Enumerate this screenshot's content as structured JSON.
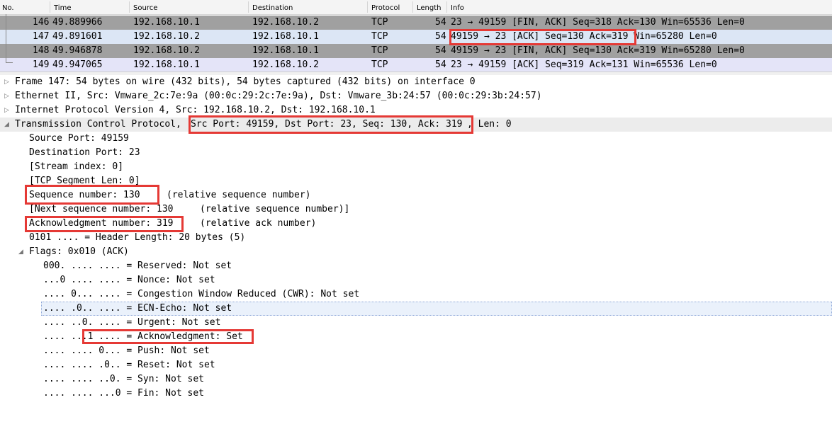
{
  "packet_list": {
    "headers": [
      "No.",
      "Time",
      "Source",
      "Destination",
      "Protocol",
      "Length",
      "Info"
    ],
    "rows": [
      {
        "no": "146",
        "time": "49.889966",
        "source": "192.168.10.1",
        "destination": "192.168.10.2",
        "protocol": "TCP",
        "length": "54",
        "info": "23 → 49159 [FIN, ACK] Seq=318 Ack=130 Win=65536 Len=0"
      },
      {
        "no": "147",
        "time": "49.891601",
        "source": "192.168.10.2",
        "destination": "192.168.10.1",
        "protocol": "TCP",
        "length": "54",
        "info": "49159 → 23 [ACK] Seq=130 Ack=319 Win=65280 Len=0"
      },
      {
        "no": "148",
        "time": "49.946878",
        "source": "192.168.10.2",
        "destination": "192.168.10.1",
        "protocol": "TCP",
        "length": "54",
        "info": "49159 → 23 [FIN, ACK] Seq=130 Ack=319 Win=65280 Len=0"
      },
      {
        "no": "149",
        "time": "49.947065",
        "source": "192.168.10.1",
        "destination": "192.168.10.2",
        "protocol": "TCP",
        "length": "54",
        "info": "23 → 49159 [ACK] Seq=319 Ack=131 Win=65536 Len=0"
      }
    ]
  },
  "detail": {
    "frame": "Frame 147: 54 bytes on wire (432 bits), 54 bytes captured (432 bits) on interface 0",
    "ethernet": "Ethernet II, Src: Vmware_2c:7e:9a (00:0c:29:2c:7e:9a), Dst: Vmware_3b:24:57 (00:0c:29:3b:24:57)",
    "ip": "Internet Protocol Version 4, Src: 192.168.10.2, Dst: 192.168.10.1",
    "tcp_prefix": "Transmission Control Protocol, ",
    "tcp_summary": "Src Port: 49159, Dst Port: 23, Seq: 130, Ack: 319",
    "tcp_suffix": ", Len: 0",
    "source_port": "Source Port: 49159",
    "destination_port": "Destination Port: 23",
    "stream_index": "[Stream index: 0]",
    "segment_len": "[TCP Segment Len: 0]",
    "seq_number": "Sequence number: 130",
    "seq_note": "(relative sequence number)",
    "next_seq": "[Next sequence number: 130",
    "next_seq_note": "(relative sequence number)]",
    "ack_number": "Acknowledgment number: 319",
    "ack_note": "(relative ack number)",
    "header_length": "0101 .... = Header Length: 20 bytes (5)",
    "flags_label": "Flags: 0x010 (ACK)",
    "flags": [
      "000. .... .... = Reserved: Not set",
      "...0 .... .... = Nonce: Not set",
      ".... 0... .... = Congestion Window Reduced (CWR): Not set",
      ".... .0.. .... = ECN-Echo: Not set",
      ".... ..0. .... = Urgent: Not set",
      ".... ...1 .... = Acknowledgment: Set",
      ".... .... 0... = Push: Not set",
      ".... .... .0.. = Reset: Not set",
      ".... .... ..0. = Syn: Not set",
      ".... .... ...0 = Fin: Not set"
    ]
  },
  "icons": {
    "collapsed": "chevron-right-icon",
    "expanded": "chevron-down-icon"
  },
  "colors": {
    "fin_row": "#a0a0a0",
    "selected_row": "#dce6f5",
    "ack_row": "#e4e4f8",
    "annotation": "#e53935"
  }
}
